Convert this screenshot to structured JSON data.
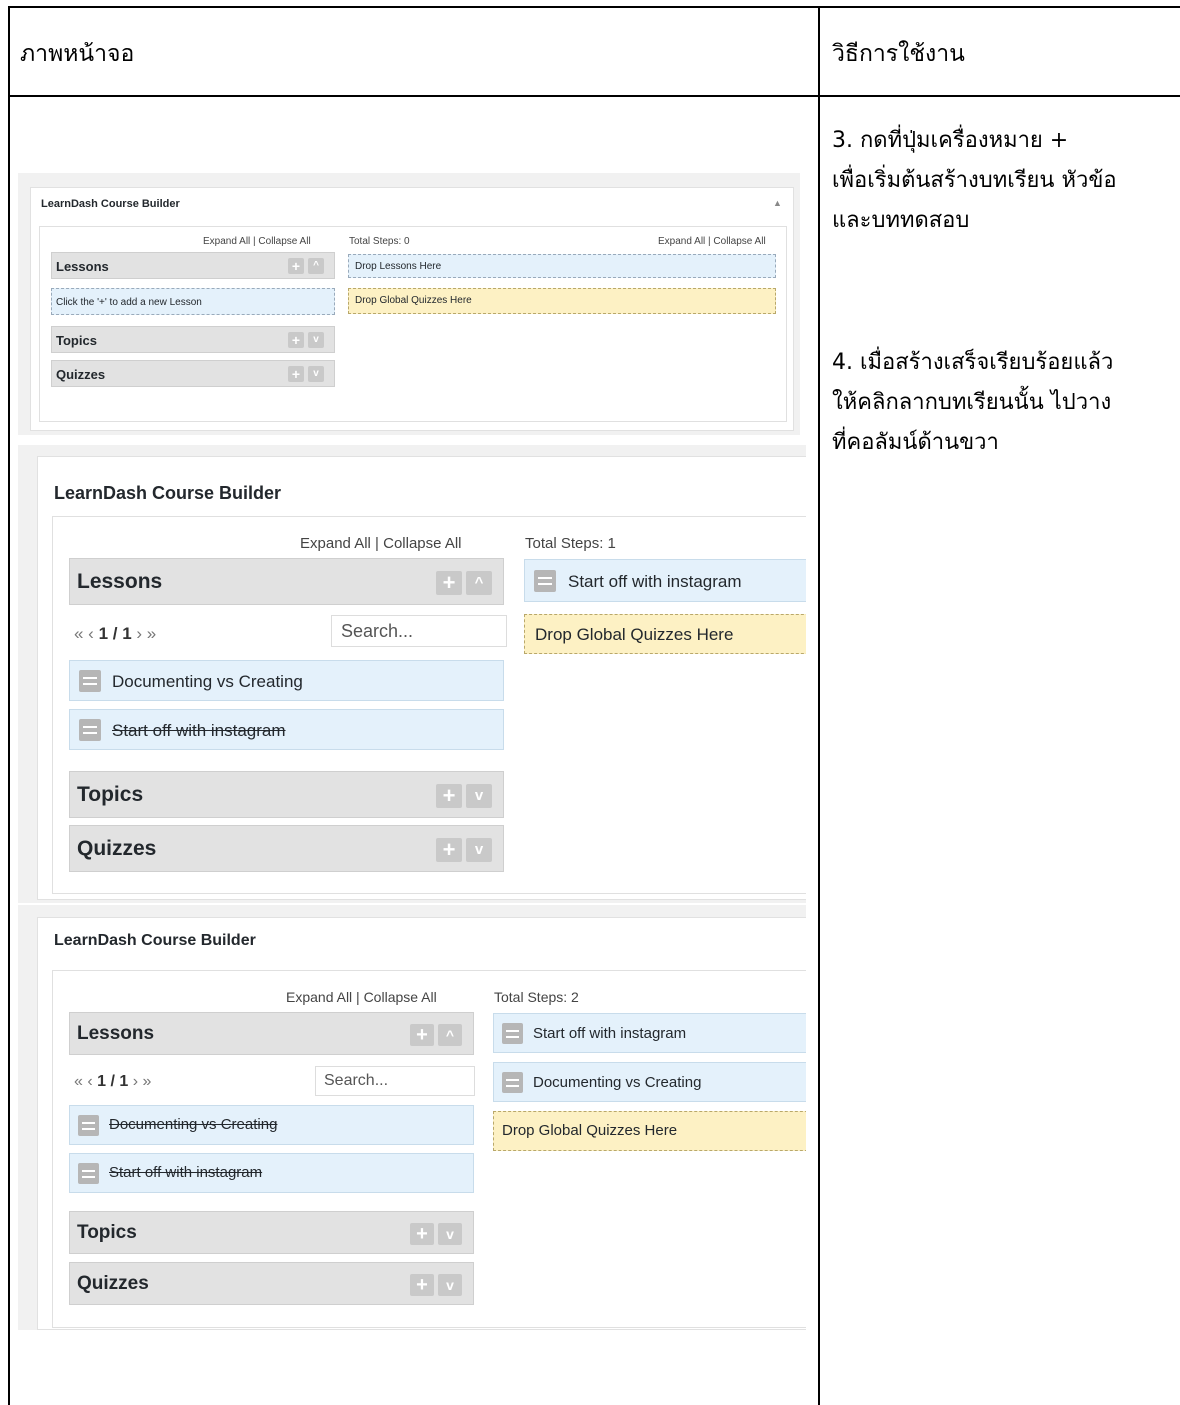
{
  "table": {
    "col1_header": "ภาพหน้าจอ",
    "col2_header": "วิธีการใช้งาน"
  },
  "instructions": [
    "3. กดที่ปุ่มเครื่องหมาย +",
    "เพื่อเริ่มต้นสร้างบทเรียน หัวข้อ",
    "และบททดสอบ",
    "4. เมื่อสร้างเสร็จเรียบร้อยแล้ว",
    "ให้คลิกลากบทเรียนนั้น ไปวาง",
    "ที่คอลัมน์ด้านขวา"
  ],
  "builder1": {
    "title": "LearnDash Course Builder",
    "left_links": "Expand All | Collapse All",
    "total_steps": "Total Steps: 0",
    "right_links": "Expand All | Collapse All",
    "lessons": "Lessons",
    "add_hint": "Click the '+' to add a new Lesson",
    "topics": "Topics",
    "quizzes": "Quizzes",
    "drop_lessons": "Drop Lessons Here",
    "drop_quizzes": "Drop Global Quizzes Here"
  },
  "builder2": {
    "title": "LearnDash Course Builder",
    "left_links": "Expand All | Collapse All",
    "total_steps": "Total Steps: 1",
    "lessons": "Lessons",
    "pager_prev": "« ‹",
    "pager": "1 / 1",
    "pager_next": "› »",
    "search_placeholder": "Search...",
    "lesson_items": [
      "Documenting vs Creating",
      "Start off with instagram"
    ],
    "step_items": [
      "Start off with instagram"
    ],
    "drop_quizzes": "Drop Global Quizzes Here",
    "topics": "Topics",
    "quizzes": "Quizzes"
  },
  "builder3": {
    "title": "LearnDash Course Builder",
    "left_links": "Expand All | Collapse All",
    "total_steps": "Total Steps: 2",
    "lessons": "Lessons",
    "pager_prev": "« ‹",
    "pager": "1 / 1",
    "pager_next": "› »",
    "search_placeholder": "Search...",
    "lesson_items": [
      "Documenting vs Creating",
      "Start off with instagram"
    ],
    "step_items": [
      "Start off with instagram",
      "Documenting vs Creating"
    ],
    "drop_quizzes": "Drop Global Quizzes Here",
    "topics": "Topics",
    "quizzes": "Quizzes"
  }
}
